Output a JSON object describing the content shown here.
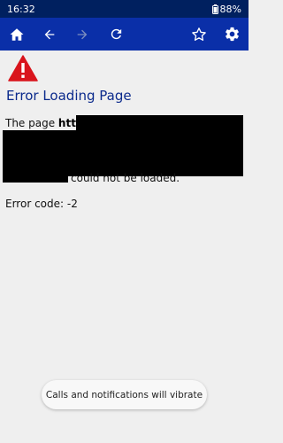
{
  "status_bar": {
    "time": "16:32",
    "battery": "88%"
  },
  "toolbar": {
    "icons": [
      "home-icon",
      "back-icon",
      "forward-icon",
      "refresh-icon",
      "star-icon",
      "settings-icon"
    ]
  },
  "page": {
    "title": "Error Loading Page",
    "message_prefix": "The page ",
    "url_visible": "http://",
    "message_suffix": "could not be loaded.",
    "error_code": "Error code: -2"
  },
  "toast": {
    "text": "Calls and notifications will vibrate"
  },
  "colors": {
    "status_bar": "#00205f",
    "toolbar": "#0a2fa8",
    "title": "#0b2a8c",
    "warning": "#d9141c"
  }
}
